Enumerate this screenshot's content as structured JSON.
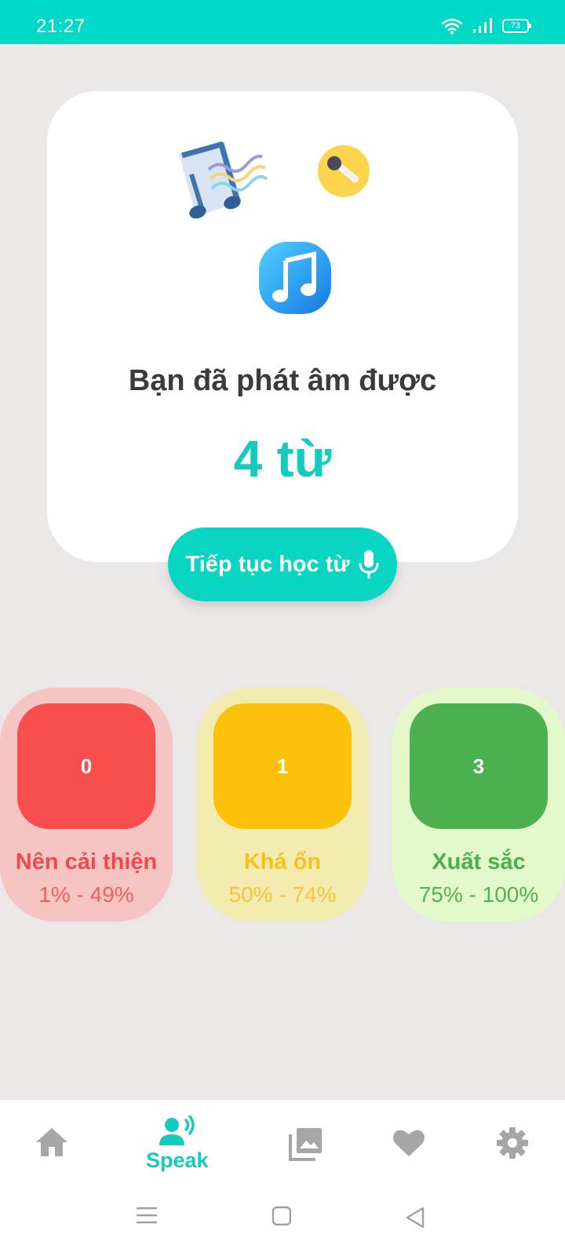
{
  "status": {
    "time": "21:27",
    "battery": "73"
  },
  "card": {
    "title": "Bạn đã phát âm được",
    "count": "4 từ"
  },
  "continue_button": {
    "label": "Tiếp tục học từ"
  },
  "scores": [
    {
      "value": "0",
      "label": "Nên cải thiện",
      "range": "1% - 49%",
      "bg": "#f7c4c4",
      "box": "#f94d4e",
      "text": "#f1494b",
      "range_text": "#ef6060"
    },
    {
      "value": "1",
      "label": "Khá ổn",
      "range": "50% - 74%",
      "bg": "#f3ecb0",
      "box": "#fdc00b",
      "text": "#f9c019",
      "range_text": "#f8c33a"
    },
    {
      "value": "3",
      "label": "Xuất sắc",
      "range": "75% - 100%",
      "bg": "#e3f9cb",
      "box": "#4caf50",
      "text": "#4caf50",
      "range_text": "#54b158"
    }
  ],
  "bottom_nav": {
    "active_label": "Speak",
    "items": [
      "home-icon",
      "speak-icon",
      "gallery-icon",
      "favorite-icon",
      "settings-icon"
    ]
  },
  "colors": {
    "accent": "#08d6c3",
    "inactive_icon": "#a6a6a6"
  }
}
